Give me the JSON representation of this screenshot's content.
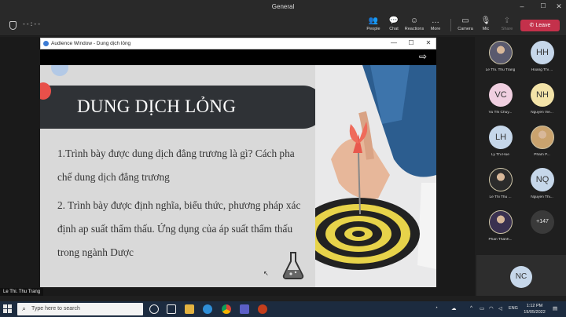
{
  "window": {
    "title": "General",
    "min": "–",
    "max": "☐",
    "close": "✕"
  },
  "toolbar": {
    "timer": "--:--",
    "buttons": [
      {
        "label": "People",
        "icon": "people-icon",
        "glyph": "👥"
      },
      {
        "label": "Chat",
        "icon": "chat-icon",
        "glyph": "💬"
      },
      {
        "label": "Reactions",
        "icon": "reactions-icon",
        "glyph": "☺"
      },
      {
        "label": "More",
        "icon": "more-icon",
        "glyph": "…"
      },
      {
        "label": "Camera",
        "icon": "camera-off-icon",
        "glyph": "▭"
      },
      {
        "label": "Mic",
        "icon": "mic-off-icon",
        "glyph": "🎙"
      },
      {
        "label": "Share",
        "icon": "share-icon",
        "glyph": "⇪"
      }
    ],
    "leave": "Leave"
  },
  "popout": {
    "title": "Audience Window - Dung dịch lỏng",
    "min": "—",
    "max": "☐",
    "close": "✕",
    "expand": "⇨"
  },
  "slide": {
    "title": "DUNG DỊCH LỎNG",
    "points": [
      "1.Trình bày được dung dịch đẳng trương là gì? Cách pha chế dung dịch đẳng trương",
      "2. Trình bày được định nghĩa, biểu thức, phương pháp xác định ap suất thẩm thấu. Ứng dụng của áp suất thẩm thấu trong ngành Dược"
    ]
  },
  "participants": [
    {
      "name": "Le Thi. Thu Trang",
      "initials": "",
      "color": "#5a5a6e",
      "photo": true
    },
    {
      "name": "Hoang Thi ...",
      "initials": "HH",
      "color": "#c6d7ea",
      "photo": false
    },
    {
      "name": "Vu Thi Chuy...",
      "initials": "VC",
      "color": "#f0cfe0",
      "photo": false
    },
    {
      "name": "Nguyen Vie...",
      "initials": "NH",
      "color": "#f3e3a8",
      "photo": false
    },
    {
      "name": "Ly Thi Hue",
      "initials": "LH",
      "color": "#c6d7ea",
      "photo": false
    },
    {
      "name": "Pham P...",
      "initials": "",
      "color": "#caa36e",
      "photo": true
    },
    {
      "name": "Le Thi Thu ...",
      "initials": "",
      "color": "#2b2b2b",
      "photo": true
    },
    {
      "name": "Nguyen Thi...",
      "initials": "NQ",
      "color": "#c6d7ea",
      "photo": false
    },
    {
      "name": "Phan Thanh...",
      "initials": "",
      "color": "#3a3150",
      "photo": true
    },
    {
      "name": "",
      "initials": "+147",
      "color": "#3a3a3a",
      "photo": false
    }
  ],
  "self": {
    "initials": "NC"
  },
  "speaker": "Le Thi. Thu Trang",
  "taskbar": {
    "search_placeholder": "Type here to search",
    "lang": "ENG",
    "time": "1:12 PM",
    "date": "19/05/2022"
  },
  "colors": {
    "leave": "#c4314b",
    "banner": "#2f3236",
    "slide_bg": "#d9d9d9",
    "taskbar": "#1c2b3f"
  }
}
